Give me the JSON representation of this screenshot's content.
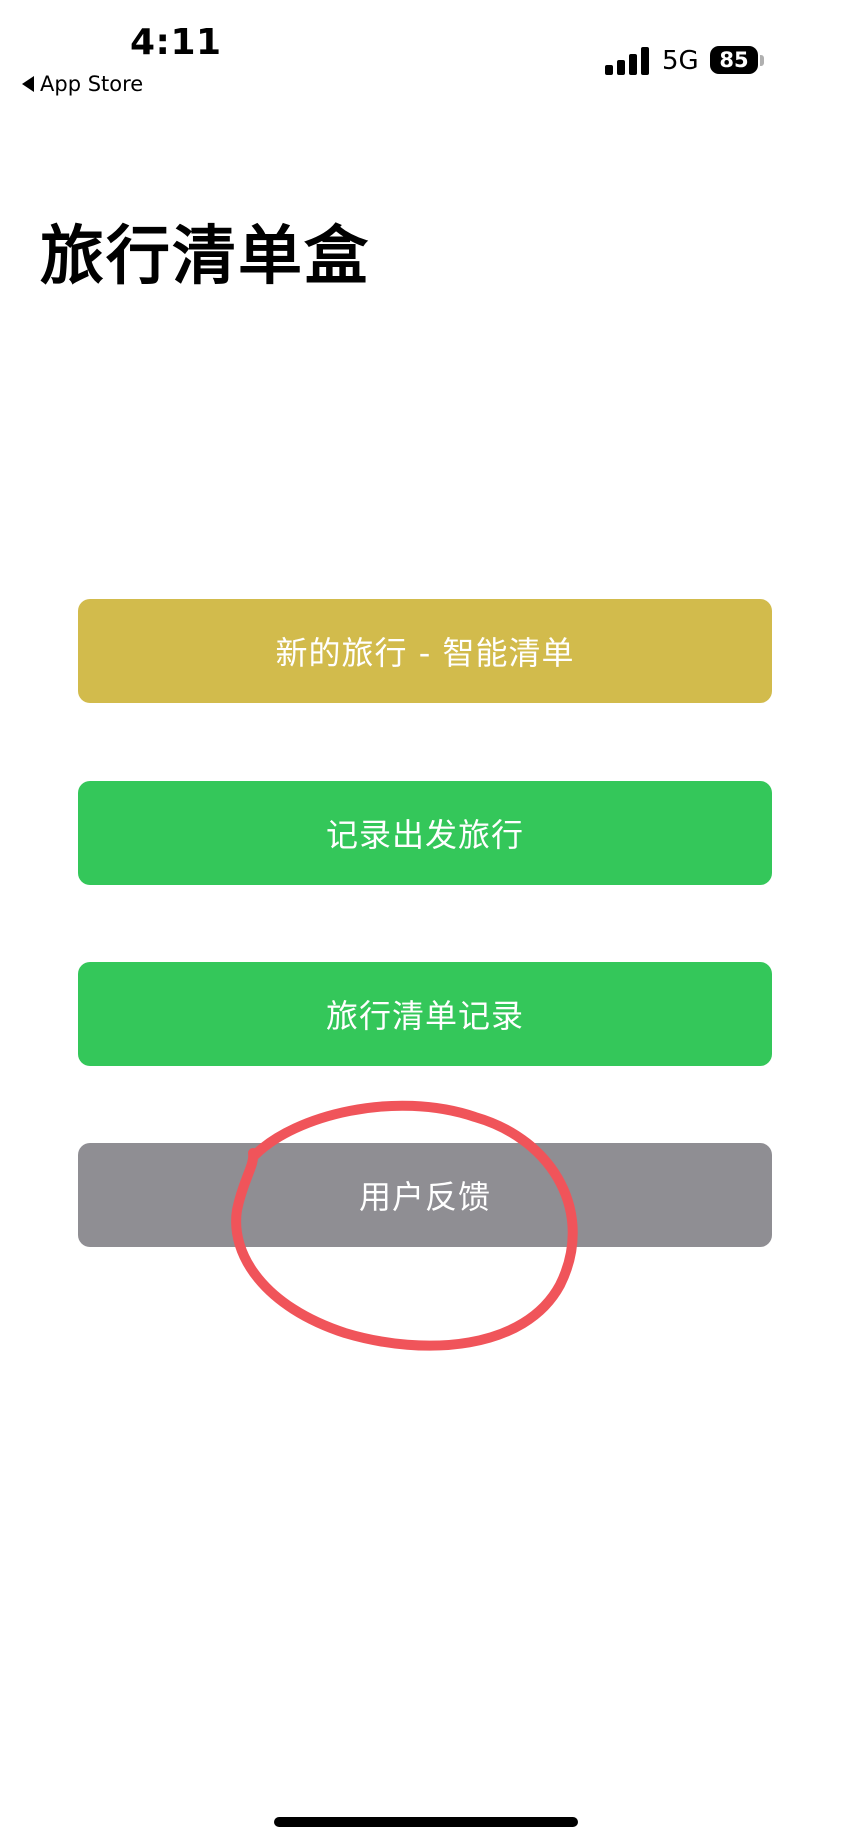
{
  "status_bar": {
    "time": "4:11",
    "back_label": "App Store",
    "network": "5G",
    "battery": "85"
  },
  "title": "旅行清单盒",
  "buttons": {
    "new_trip": "新的旅行 - 智能清单",
    "record_departure": "记录出发旅行",
    "list_history": "旅行清单记录",
    "feedback": "用户反馈"
  },
  "colors": {
    "new_trip_bg": "#d2bb4c",
    "green_bg": "#34c75a",
    "feedback_bg": "#8f8e93",
    "annotation": "#f0545a"
  },
  "icons": {
    "back": "back-arrow-icon",
    "signal": "cellular-signal-icon",
    "battery": "battery-icon"
  }
}
